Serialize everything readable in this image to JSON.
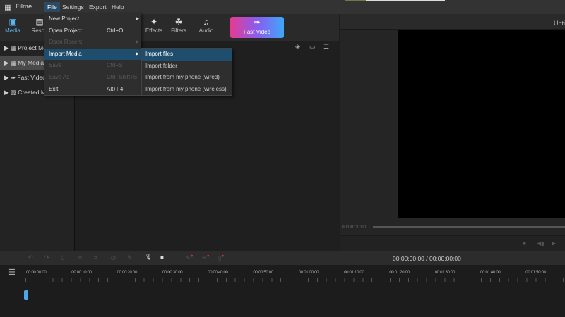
{
  "app": {
    "title": "Filme"
  },
  "menubar": [
    "File",
    "Settings",
    "Export",
    "Help"
  ],
  "toolbar": {
    "tabs": [
      {
        "label": "Media",
        "icon": "media-icon"
      },
      {
        "label": "Resou",
        "icon": "resource-icon"
      },
      {
        "label": "Effects",
        "icon": "effects-icon"
      },
      {
        "label": "Filters",
        "icon": "filters-icon"
      },
      {
        "label": "Audio",
        "icon": "audio-icon"
      }
    ],
    "fast_video": "Fast Video"
  },
  "sidebar": {
    "items": [
      {
        "label": "Project Media"
      },
      {
        "label": "My Media"
      },
      {
        "label": "Fast Video"
      },
      {
        "label": "Created Media"
      }
    ]
  },
  "preview": {
    "title": "Untitled",
    "time": "00:00:00:00"
  },
  "file_menu": [
    {
      "label": "New Project",
      "shortcut": "",
      "submenu": true,
      "disabled": false
    },
    {
      "label": "Open Project",
      "shortcut": "Ctrl+O",
      "submenu": false,
      "disabled": false
    },
    {
      "label": "Open Recent",
      "shortcut": "",
      "submenu": true,
      "disabled": true
    },
    {
      "label": "Import Media",
      "shortcut": "",
      "submenu": true,
      "disabled": false
    },
    {
      "label": "Save",
      "shortcut": "Ctrl+S",
      "submenu": false,
      "disabled": true
    },
    {
      "label": "Save As",
      "shortcut": "Ctrl+Shift+S",
      "submenu": false,
      "disabled": true
    },
    {
      "label": "Exit",
      "shortcut": "Alt+F4",
      "submenu": false,
      "disabled": false
    }
  ],
  "import_submenu": [
    "Import files",
    "Import folder",
    "Import from my phone (wired)",
    "Import from my phone (wireless)"
  ],
  "timeline": {
    "timecode": "00:00:00:00 / 00:00:00:00",
    "ticks": [
      "00:00:00:00",
      "00:00:10:00",
      "00:00:20:00",
      "00:00:30:00",
      "00:00:40:00",
      "00:00:50:00",
      "00:01:00:00",
      "00:01:10:00",
      "00:01:20:00",
      "00:01:30:00",
      "00:01:40:00",
      "00:01:50:00"
    ]
  },
  "colors": {
    "accent": "#5ab4f0",
    "highlight": "#1f4d6e"
  }
}
